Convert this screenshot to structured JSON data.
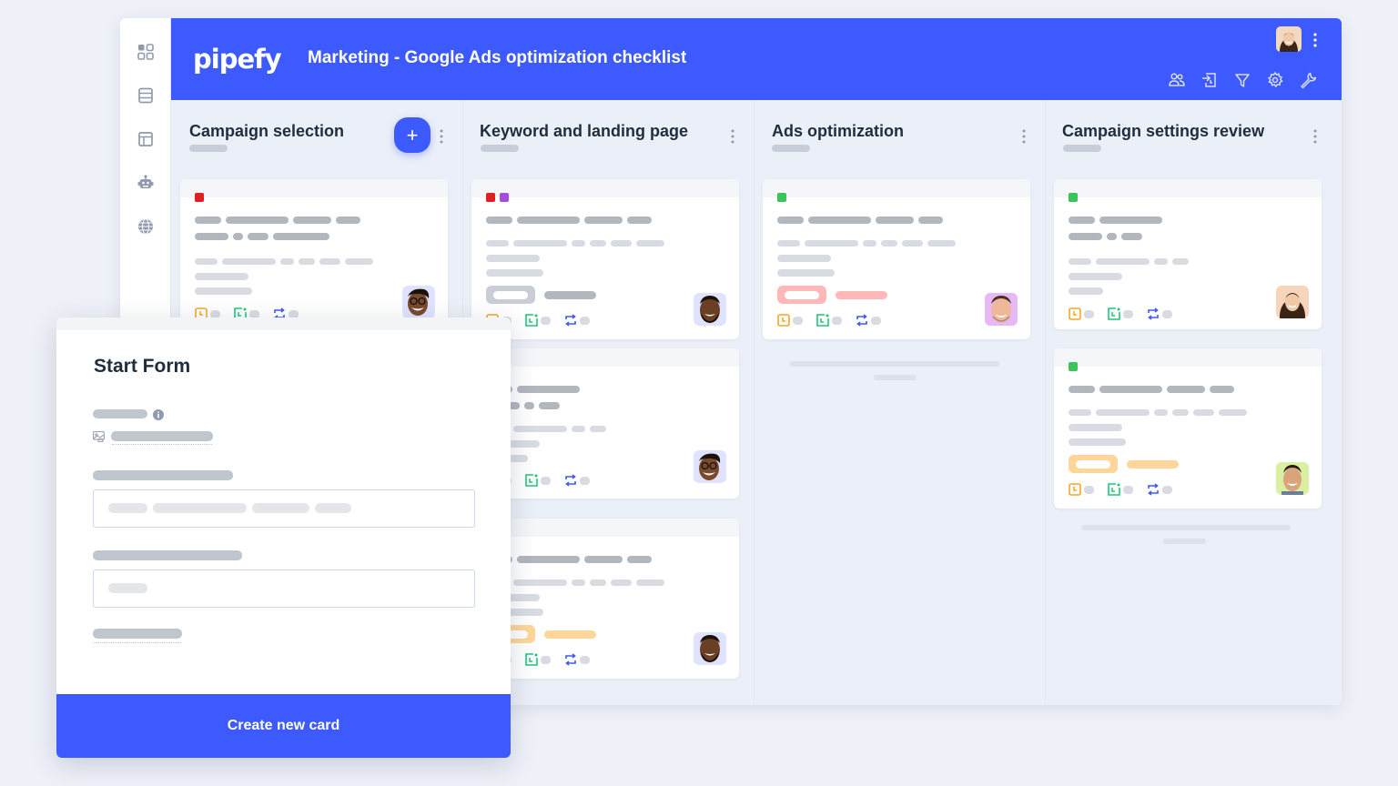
{
  "app": {
    "logo": "pipefy",
    "pipe_title": "Marketing - Google Ads optimization checklist"
  },
  "rail": {
    "items": [
      {
        "name": "apps-grid-icon"
      },
      {
        "name": "database-icon"
      },
      {
        "name": "portal-icon"
      },
      {
        "name": "automation-bot-icon"
      },
      {
        "name": "globe-icon"
      }
    ]
  },
  "topbar": {
    "tools": [
      "members-icon",
      "import-icon",
      "filter-icon",
      "settings-gear-icon",
      "wrench-icon"
    ]
  },
  "phases": [
    {
      "title": "Campaign selection",
      "has_add_button": true,
      "add_label": "+"
    },
    {
      "title": "Keyword and landing page"
    },
    {
      "title": "Ads optimization"
    },
    {
      "title": "Campaign settings review"
    }
  ],
  "colors": {
    "brand": "#3d5afe",
    "label_red": "#e02020",
    "label_purple": "#a24ee0",
    "label_green": "#3cc35a",
    "tag_red": "#ffb8b8",
    "tag_orange": "#ffd699",
    "tag_gray": "#c9ced6",
    "icon_orange": "#f5a623",
    "icon_green": "#1fc77a",
    "icon_blue": "#3d5afe"
  },
  "form": {
    "title": "Start Form",
    "submit_label": "Create new card"
  }
}
